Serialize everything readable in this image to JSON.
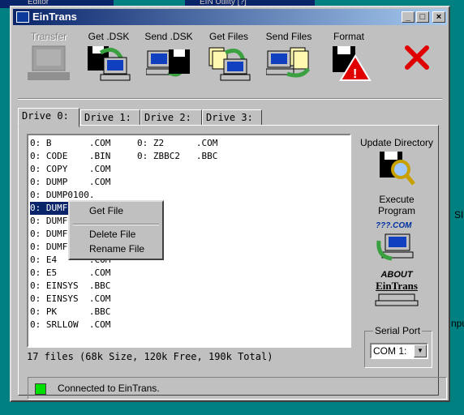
{
  "background": {
    "left_title": "Editor",
    "right_title": "EIN Utility [?]",
    "right_edge_text": "SI",
    "right_edge_text2": "npu"
  },
  "window": {
    "title": "EinTrans"
  },
  "toolbar": [
    {
      "label": "Transfer",
      "icon": "computer-icon",
      "disabled": true
    },
    {
      "label": "Get .DSK",
      "icon": "floppy-get-dsk-icon",
      "disabled": false
    },
    {
      "label": "Send .DSK",
      "icon": "floppy-send-dsk-icon",
      "disabled": false
    },
    {
      "label": "Get Files",
      "icon": "get-files-icon",
      "disabled": false
    },
    {
      "label": "Send Files",
      "icon": "send-files-icon",
      "disabled": false
    },
    {
      "label": "Format",
      "icon": "format-warning-icon",
      "disabled": false
    },
    {
      "label": "",
      "icon": "close-x-icon",
      "disabled": false
    }
  ],
  "tabs": [
    "Drive 0:",
    "Drive 1:",
    "Drive 2:",
    "Drive 3:"
  ],
  "files": [
    {
      "c1": "0: B       .COM",
      "c2": "0: Z2      .COM"
    },
    {
      "c1": "0: CODE    .BIN",
      "c2": "0: ZBBC2   .BBC"
    },
    {
      "c1": "0: COPY    .COM",
      "c2": ""
    },
    {
      "c1": "0: DUMP    .COM",
      "c2": ""
    },
    {
      "c1": "0: DUMP0100.",
      "c2": ""
    },
    {
      "c1": "0: DUMF",
      "c2": "",
      "selected": true
    },
    {
      "c1": "0: DUMF",
      "c2": ""
    },
    {
      "c1": "0: DUMF",
      "c2": ""
    },
    {
      "c1": "0: DUMF",
      "c2": ""
    },
    {
      "c1": "0: E4      .COM",
      "c2": ""
    },
    {
      "c1": "0: E5      .COM",
      "c2": ""
    },
    {
      "c1": "0: EINSYS  .BBC",
      "c2": ""
    },
    {
      "c1": "0: EINSYS  .COM",
      "c2": ""
    },
    {
      "c1": "0: PK      .BBC",
      "c2": ""
    },
    {
      "c1": "0: SRLLOW  .COM",
      "c2": ""
    }
  ],
  "context_menu": {
    "get": "Get File",
    "delete": "Delete File",
    "rename": "Rename File"
  },
  "summary": "17 files (68k Size, 120k Free, 190k Total)",
  "side": {
    "update": "Update Directory",
    "execute": "Execute Program",
    "execute_icon_text": "???.COM",
    "about_line1": "ABOUT",
    "about_line2": "EinTrans"
  },
  "serial": {
    "legend": "Serial Port",
    "value": "COM 1:"
  },
  "statusbar": {
    "text": "Connected to EinTrans.",
    "led_color": "#00e000"
  }
}
